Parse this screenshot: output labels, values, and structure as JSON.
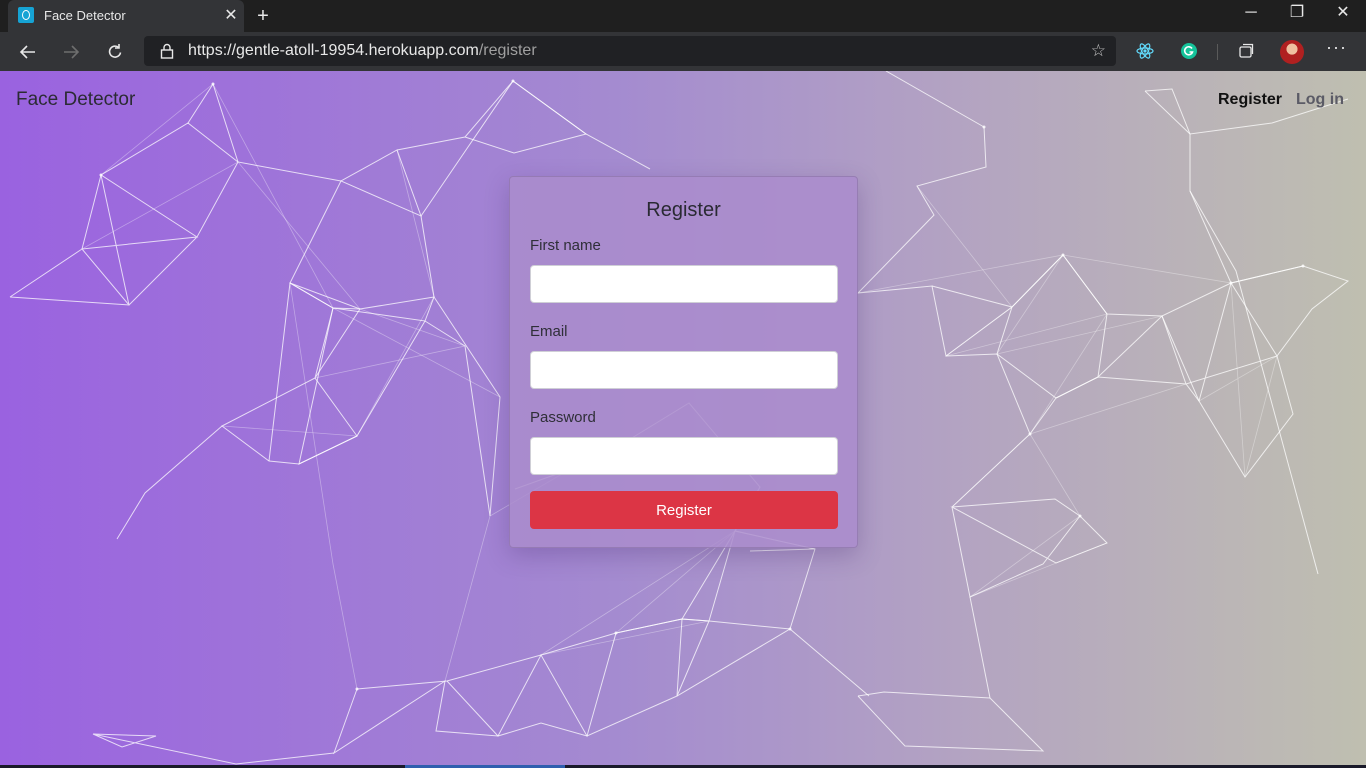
{
  "browser": {
    "tab": {
      "title": "Face Detector",
      "close_glyph": "✕"
    },
    "new_tab_glyph": "+",
    "window_controls": {
      "minimize": "─",
      "restore": "❐",
      "close": "✕"
    },
    "address": {
      "origin": "https://gentle-atoll-19954.herokuapp.com",
      "path": "/register"
    },
    "more_glyph": "···",
    "star_glyph": "☆"
  },
  "page": {
    "brand": "Face Detector",
    "nav": {
      "register": "Register",
      "login": "Log in"
    },
    "form": {
      "title": "Register",
      "first_name_label": "First name",
      "email_label": "Email",
      "password_label": "Password",
      "first_name_value": "",
      "email_value": "",
      "password_value": "",
      "submit_label": "Register"
    }
  },
  "colors": {
    "submit_button": "#dc3545",
    "gradient_left": "#9a62e0",
    "gradient_right": "#bfbfb0"
  }
}
